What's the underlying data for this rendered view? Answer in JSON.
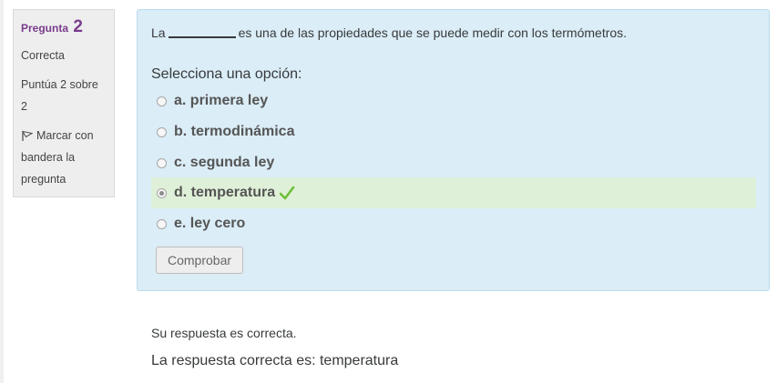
{
  "info": {
    "question_label": "Pregunta",
    "question_number": "2",
    "state": "Correcta",
    "grade": "Puntúa 2 sobre 2",
    "flag_label": "Marcar con bandera la pregunta"
  },
  "question": {
    "text_before": "La",
    "text_after": "es una de las propiedades que se puede medir con los termómetros.",
    "prompt": "Selecciona una opción:",
    "options": [
      {
        "label": "a. primera ley",
        "checked": false,
        "correct": false
      },
      {
        "label": "b. termodinámica",
        "checked": false,
        "correct": false
      },
      {
        "label": "c. segunda ley",
        "checked": false,
        "correct": false
      },
      {
        "label": "d. temperatura",
        "checked": true,
        "correct": true
      },
      {
        "label": "e. ley cero",
        "checked": false,
        "correct": false
      }
    ],
    "check_button": "Comprobar"
  },
  "feedback": {
    "result": "Su respuesta es correcta.",
    "right_answer": "La respuesta correcta es: temperatura"
  },
  "colors": {
    "accent": "#7a3d8c",
    "panel_bg": "#dbedf7",
    "correct_bg": "#dff0d8",
    "check_green": "#6fbf3a"
  }
}
